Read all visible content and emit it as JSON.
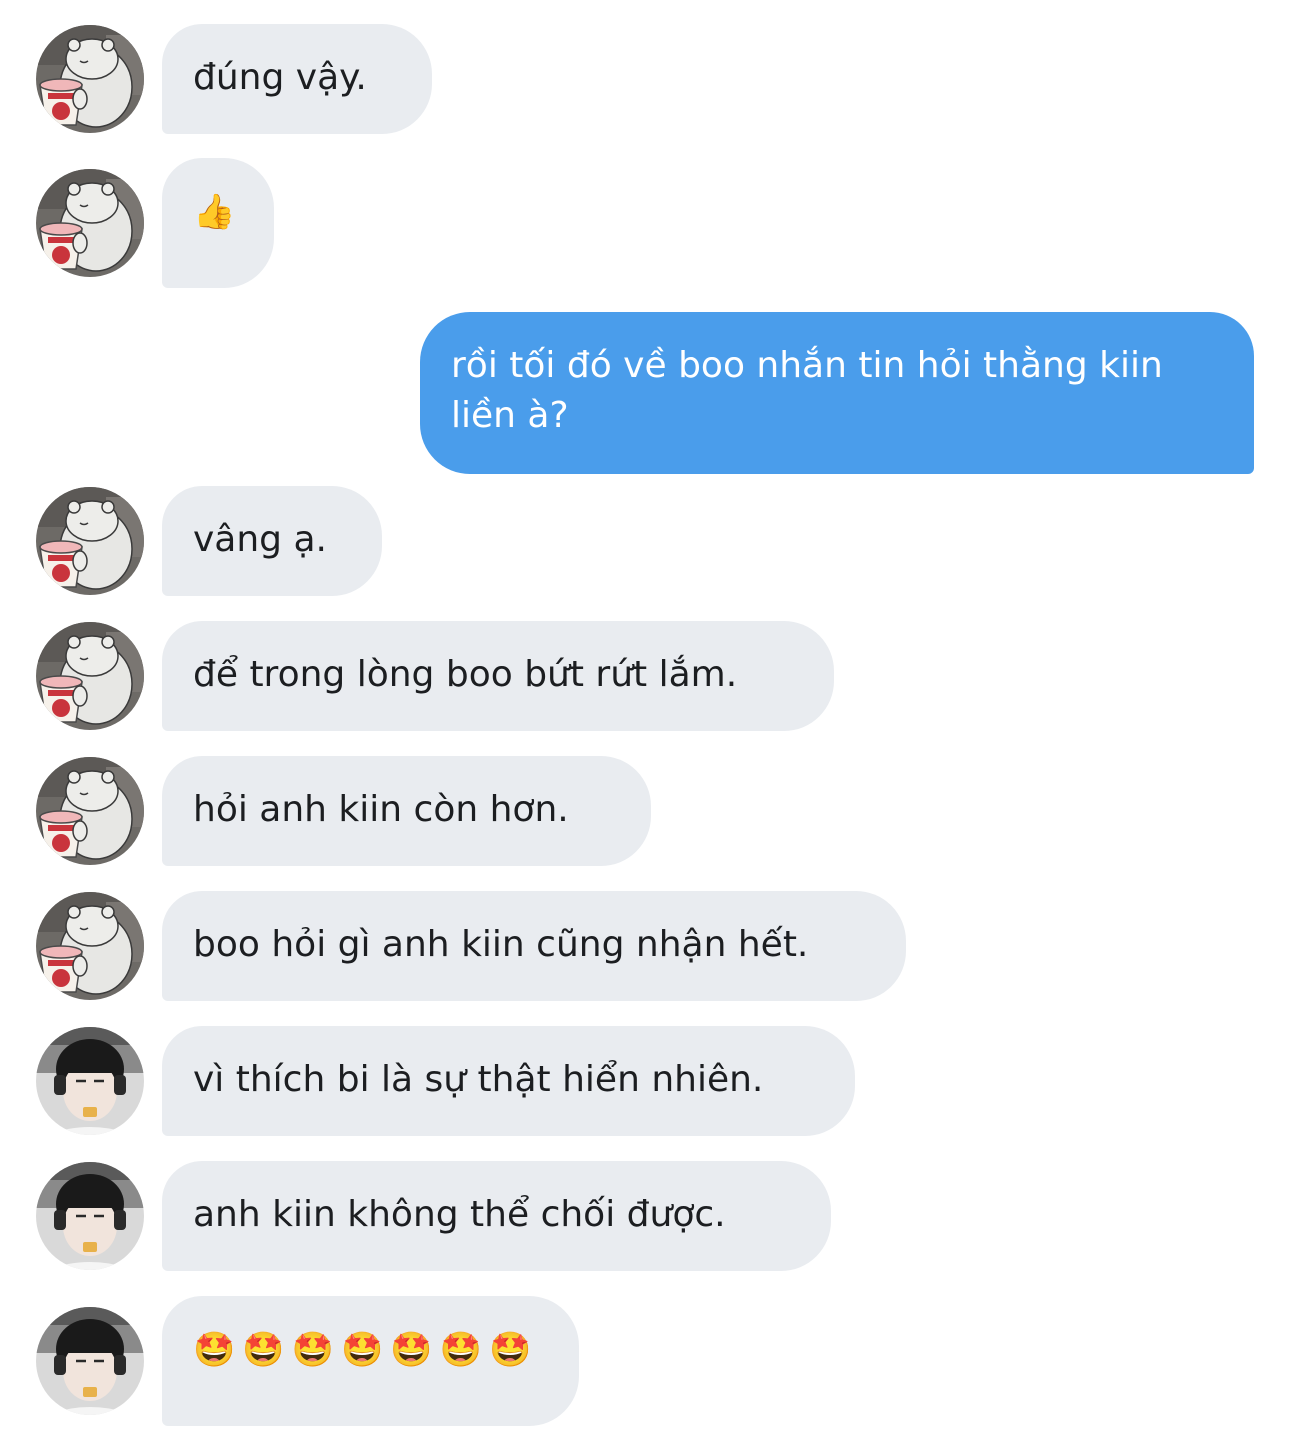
{
  "conversation": {
    "messages": [
      {
        "side": "in",
        "sender": "bear",
        "text": "đúng vậy."
      },
      {
        "side": "in",
        "sender": "bear",
        "text": "👍"
      },
      {
        "side": "out",
        "text": "rồi tối đó về boo nhắn tin hỏi thằng kiin liền à?"
      },
      {
        "side": "in",
        "sender": "bear",
        "text": "vâng ạ."
      },
      {
        "side": "in",
        "sender": "bear",
        "text": "để trong lòng boo bứt rứt lắm."
      },
      {
        "side": "in",
        "sender": "bear",
        "text": "hỏi anh kiin còn hơn."
      },
      {
        "side": "in",
        "sender": "bear",
        "text": "boo hỏi gì anh kiin cũng nhận hết."
      },
      {
        "side": "in",
        "sender": "person",
        "text": "vì thích bi là sự thật hiển nhiên."
      },
      {
        "side": "in",
        "sender": "person",
        "text": "anh kiin không thể chối được."
      },
      {
        "side": "in",
        "sender": "person",
        "emojis": [
          "🤩",
          "🤩",
          "🤩",
          "🤩",
          "🤩",
          "🤩",
          "🤩"
        ]
      }
    ]
  },
  "colors": {
    "incoming_bubble": "#e9ecf0",
    "outgoing_bubble": "#4a9deb",
    "incoming_text": "#1c1e21",
    "outgoing_text": "#ffffff"
  },
  "icons": {
    "bear_avatar": "bear-with-ice-cream-icon",
    "person_avatar": "person-photo-icon",
    "thumbs_up": "thumbs-up-icon",
    "star_struck": "star-struck-emoji-icon"
  }
}
